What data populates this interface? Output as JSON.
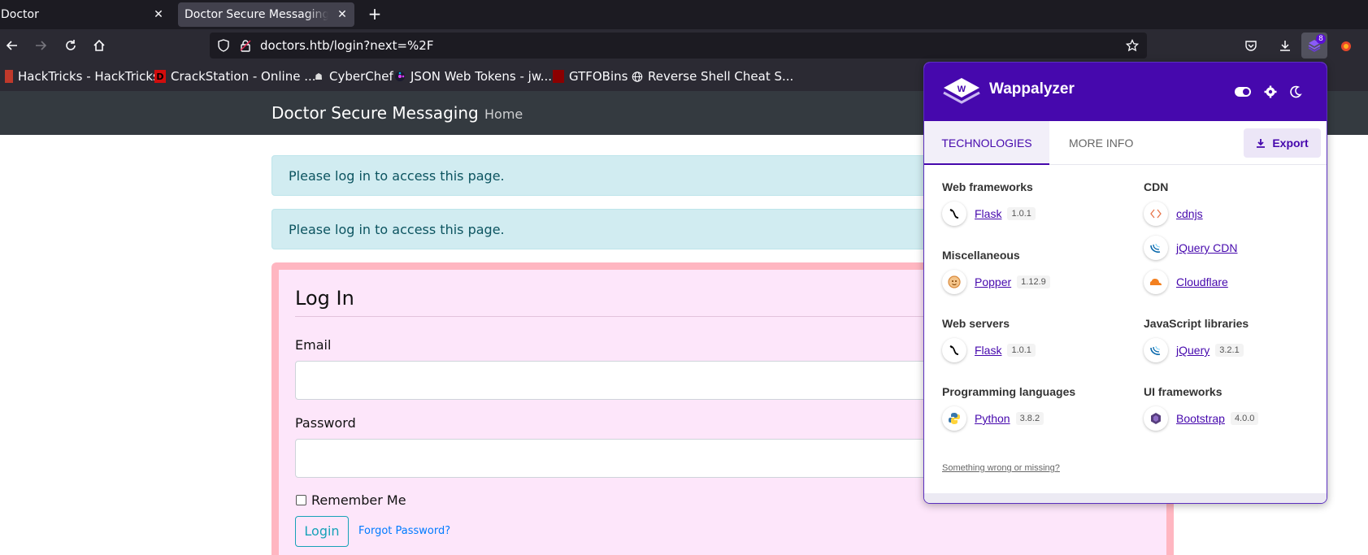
{
  "browser": {
    "tabs": [
      {
        "title": "Doctor"
      },
      {
        "title": "Doctor Secure Messaging - Login"
      }
    ],
    "url": "doctors.htb/login?next=%2F",
    "extension_badge": "8",
    "bookmarks": [
      {
        "label": "HackTricks - HackTricks"
      },
      {
        "label": "CrackStation - Online ..."
      },
      {
        "label": "CyberChef"
      },
      {
        "label": "JSON Web Tokens - jw..."
      },
      {
        "label": "GTFOBins"
      },
      {
        "label": "Reverse Shell Cheat S..."
      }
    ]
  },
  "site": {
    "brand": "Doctor Secure Messaging",
    "nav_home": "Home",
    "alerts": [
      "Please log in to access this page.",
      "Please log in to access this page."
    ],
    "login": {
      "title": "Log In",
      "email_label": "Email",
      "password_label": "Password",
      "remember_label": "Remember Me",
      "login_button": "Login",
      "forgot_link": "Forgot Password?"
    }
  },
  "wappalyzer": {
    "name": "Wappalyzer",
    "tab_technologies": "TECHNOLOGIES",
    "tab_more_info": "MORE INFO",
    "export_label": "Export",
    "left_column": [
      {
        "category": "Web frameworks",
        "techs": [
          {
            "name": "Flask",
            "version": "1.0.1",
            "icon": "flask-icon"
          }
        ]
      },
      {
        "category": "Miscellaneous",
        "techs": [
          {
            "name": "Popper",
            "version": "1.12.9",
            "icon": "popper-icon"
          }
        ]
      },
      {
        "category": "Web servers",
        "techs": [
          {
            "name": "Flask",
            "version": "1.0.1",
            "icon": "flask-icon"
          }
        ]
      },
      {
        "category": "Programming languages",
        "techs": [
          {
            "name": "Python",
            "version": "3.8.2",
            "icon": "python-icon"
          }
        ]
      }
    ],
    "right_column": [
      {
        "category": "CDN",
        "techs": [
          {
            "name": "cdnjs",
            "version": "",
            "icon": "cdnjs-icon"
          },
          {
            "name": "jQuery CDN",
            "version": "",
            "icon": "jquery-icon"
          },
          {
            "name": "Cloudflare",
            "version": "",
            "icon": "cloudflare-icon"
          }
        ]
      },
      {
        "category": "JavaScript libraries",
        "techs": [
          {
            "name": "jQuery",
            "version": "3.2.1",
            "icon": "jquery-icon"
          }
        ]
      },
      {
        "category": "UI frameworks",
        "techs": [
          {
            "name": "Bootstrap",
            "version": "4.0.0",
            "icon": "bootstrap-icon"
          }
        ]
      }
    ],
    "footer_link": "Something wrong or missing?"
  }
}
